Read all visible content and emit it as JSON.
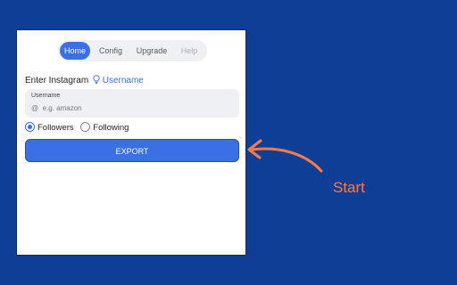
{
  "tabs": [
    {
      "label": "Home",
      "state": "active"
    },
    {
      "label": "Config",
      "state": "normal"
    },
    {
      "label": "Upgrade",
      "state": "normal"
    },
    {
      "label": "Help",
      "state": "disabled"
    }
  ],
  "prompt": {
    "text": "Enter Instagram",
    "link": "Username",
    "icon": "lightbulb-icon"
  },
  "username_field": {
    "label": "Username",
    "placeholder": "@  e.g. amazon",
    "value": ""
  },
  "options": {
    "followers": {
      "label": "Followers",
      "selected": true
    },
    "following": {
      "label": "Following",
      "selected": false
    }
  },
  "export_button": {
    "label": "EXPORT"
  },
  "callout": {
    "text": "Start",
    "color": "#ff7a45"
  },
  "colors": {
    "background": "#0d3f96",
    "accent": "#3a70e4"
  }
}
